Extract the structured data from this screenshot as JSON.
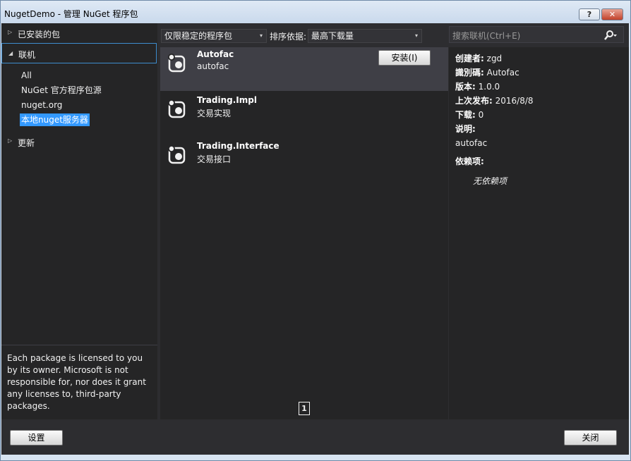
{
  "window": {
    "title": "NugetDemo - 管理 NuGet 程序包",
    "help_label": "?",
    "close_label": "✕"
  },
  "sidebar": {
    "installed": {
      "arrow": "▷",
      "label": "已安装的包"
    },
    "online": {
      "arrow": "◢",
      "label": "联机"
    },
    "sources": [
      "All",
      "NuGet 官方程序包源",
      "nuget.org",
      "本地nuget服务器"
    ],
    "updates": {
      "arrow": "▷",
      "label": "更新"
    },
    "license_text": "Each package is licensed to you by its owner. Microsoft is not responsible for, nor does it grant any licenses to, third-party packages."
  },
  "filter": {
    "stability_value": "仅限稳定的程序包",
    "sort_label": "排序依据:",
    "sort_value": "最高下载量",
    "caret": "▾"
  },
  "packages": [
    {
      "name": "Autofac",
      "desc": "autofac",
      "install_label": "安装(I)"
    },
    {
      "name": "Trading.Impl",
      "desc": "交易实现"
    },
    {
      "name": "Trading.Interface",
      "desc": "交易接口"
    }
  ],
  "pager": {
    "current_page": "1"
  },
  "search": {
    "placeholder": "搜索联机(Ctrl+E)",
    "icon": "search-icon"
  },
  "details": {
    "creator_label": "创建者:",
    "creator": "zgd",
    "id_label": "識別碼:",
    "id": "Autofac",
    "version_label": "版本:",
    "version": "1.0.0",
    "published_label": "上次发布:",
    "published": "2016/8/8",
    "downloads_label": "下载:",
    "downloads": "0",
    "description_label": "说明:",
    "description": "autofac",
    "dependencies_label": "依赖项:",
    "no_dependencies": "无依赖项"
  },
  "footer": {
    "settings_label": "设置",
    "close_label": "关闭"
  },
  "colors": {
    "background": "#2d2d30",
    "panel": "#252526",
    "accent": "#3399ff"
  }
}
